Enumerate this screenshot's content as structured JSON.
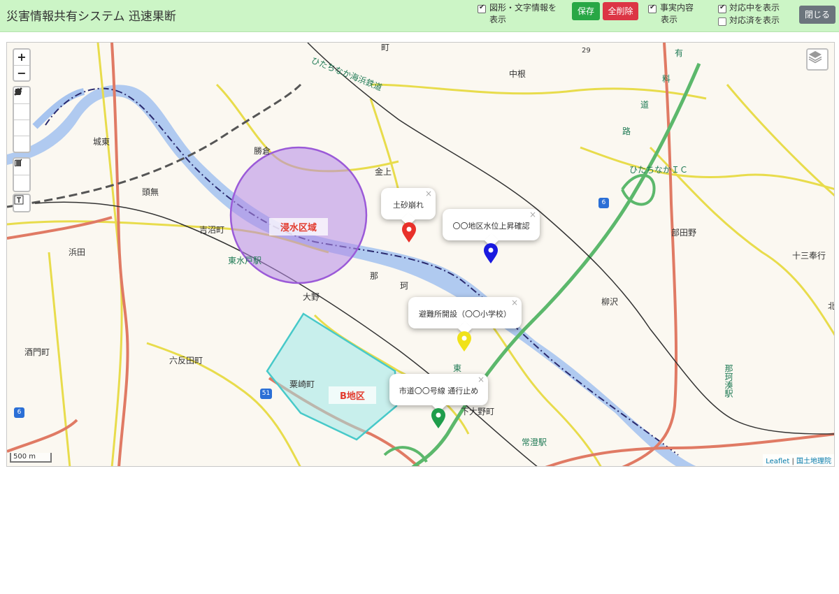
{
  "header": {
    "title": "災害情報共有システム 迅速果断",
    "show_shapes_line1": "図形・文字情報を",
    "show_shapes_line2": "表示",
    "save_label": "保存",
    "clear_label": "全削除",
    "show_facts_line1": "事実内容",
    "show_facts_line2": "表示",
    "show_active": "対応中を表示",
    "show_done": "対応済を表示",
    "close_label": "閉じる",
    "checks": {
      "shapes": true,
      "facts": true,
      "active": true,
      "done": false
    }
  },
  "map": {
    "zoom_in": "+",
    "zoom_out": "−",
    "scale": "500 m",
    "attribution_leaflet": "Leaflet",
    "attribution_sep": " | ",
    "attribution_gsi": "国土地理院",
    "zones": {
      "flood": "浸水区域",
      "district_b": "B地区"
    },
    "popups": [
      {
        "text": "土砂崩れ",
        "color": "#e8312a"
      },
      {
        "text": "〇〇地区水位上昇確認",
        "color": "#1a1adf"
      },
      {
        "text": "避難所開設（〇〇小学校）",
        "color": "#f0e21a"
      },
      {
        "text": "市道〇〇号線 通行止め",
        "color": "#1f9d4b"
      }
    ],
    "place_labels": {
      "jonan": "城東",
      "kazuki": "勝倉",
      "kanagami": "金上",
      "nakane": "中根",
      "hitachinaka_ic": "ひたちなかＩＣ",
      "hitachinaka_rail": "ひたちなか海浜鉄道",
      "bushida": "部田野",
      "jusanbugyo": "十三奉行",
      "kawarago": "頭無",
      "yoshinuma": "吉沼町",
      "higashimito": "東水戸駅",
      "hamada": "浜田",
      "oono": "大野",
      "yanagisawa": "柳沢",
      "sakadomachi": "酒門町",
      "rokutanda": "六反田町",
      "awasaki": "粟崎町",
      "shimooono": "下大野町",
      "tokiwa": "常澄駅",
      "nakaminato": "那珂湊駅",
      "naka": "那",
      "ka": "珂",
      "route": "6",
      "route2": "51",
      "elev": "29",
      "michi": "町",
      "kita": "北",
      "yu": "有",
      "ryo": "料",
      "do": "道",
      "ro": "路",
      "toride": "東"
    }
  }
}
